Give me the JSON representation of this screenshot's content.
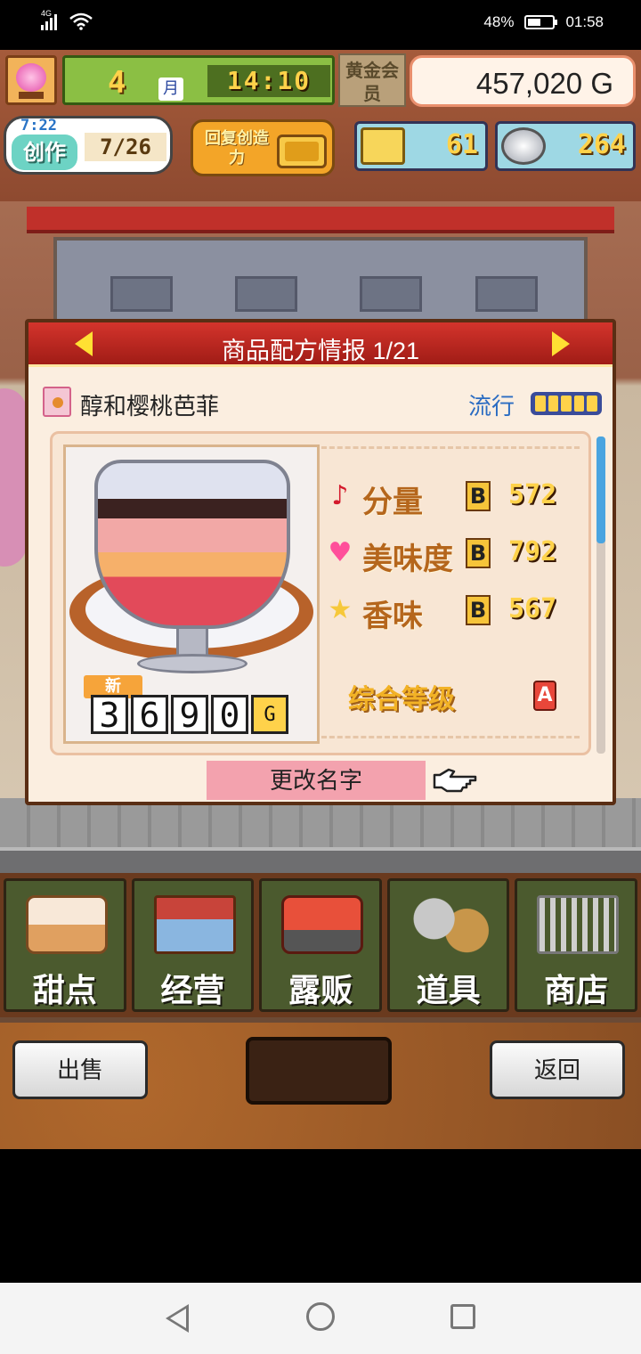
{
  "status_bar": {
    "network": "4G",
    "battery": "48%",
    "time": "01:58"
  },
  "hud": {
    "month_number": "4",
    "month_unit": "月",
    "clock": "14:10",
    "member_badge": "黄金会员",
    "money": "457,020 G",
    "create_timer": "7:22",
    "create_label": "创作",
    "create_count": "7/26",
    "restore_label": "回复创造力",
    "tickets": "61",
    "medals": "264"
  },
  "dialog": {
    "title": "商品配方情报 1/21",
    "product_name": "醇和樱桃芭菲",
    "trend_label": "流行",
    "trend_level": 5,
    "new_tag": "新",
    "price_digits": [
      "3",
      "6",
      "9",
      "0"
    ],
    "price_unit": "G",
    "stats": [
      {
        "icon": "music-note-icon",
        "glyph": "♪",
        "color": "#d41a2c",
        "label": "分量",
        "grade": "B",
        "value": "572"
      },
      {
        "icon": "heart-icon",
        "glyph": "♥",
        "color": "#ff4f9a",
        "label": "美味度",
        "grade": "B",
        "value": "792"
      },
      {
        "icon": "star-icon",
        "glyph": "★",
        "color": "#f6c83a",
        "label": "香味",
        "grade": "B",
        "value": "567"
      }
    ],
    "total_label": "综合等级",
    "total_grade": "A",
    "rename_button": "更改名字"
  },
  "menu": [
    {
      "icon": "cake-icon",
      "label": "甜点"
    },
    {
      "icon": "shop-icon",
      "label": "经营"
    },
    {
      "icon": "food-truck-icon",
      "label": "露贩"
    },
    {
      "icon": "items-icon",
      "label": "道具"
    },
    {
      "icon": "cart-icon",
      "label": "商店"
    }
  ],
  "actions": {
    "sell": "出售",
    "back": "返回"
  }
}
